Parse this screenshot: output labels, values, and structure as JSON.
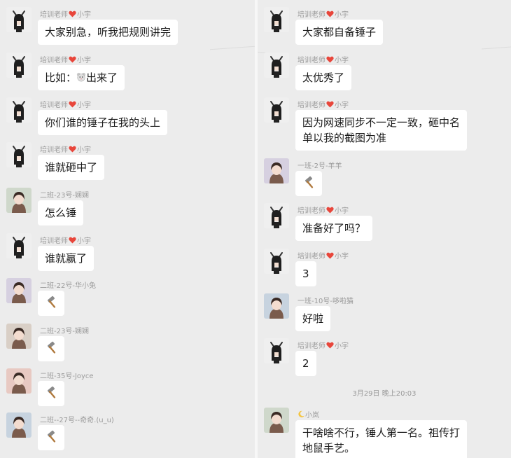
{
  "left": [
    {
      "sender": "培训老师",
      "name2": "小宇",
      "teacher": true,
      "text": "大家别急，听我把规则讲完",
      "avatar": "teacher-avatar"
    },
    {
      "sender": "培训老师",
      "name2": "小宇",
      "teacher": true,
      "text_pre": "比如：",
      "text_post": "出来了",
      "emoji": "mouse-emoji-icon",
      "avatar": "teacher-avatar"
    },
    {
      "sender": "培训老师",
      "name2": "小宇",
      "teacher": true,
      "text": "你们谁的锤子在我的头上",
      "avatar": "teacher-avatar"
    },
    {
      "sender": "培训老师",
      "name2": "小宇",
      "teacher": true,
      "text": "谁就砸中了",
      "avatar": "teacher-avatar"
    },
    {
      "sender": "二班-23号-娴娴",
      "text": "怎么锤",
      "avatar": "student-avatar"
    },
    {
      "sender": "培训老师",
      "name2": "小宇",
      "teacher": true,
      "text": "谁就赢了",
      "avatar": "teacher-avatar"
    },
    {
      "sender": "二班-22号-华小兔",
      "hammer": true,
      "avatar": "student-avatar"
    },
    {
      "sender": "二班-23号-娴娴",
      "hammer": true,
      "avatar": "student-avatar"
    },
    {
      "sender": "二班-35号-Joyce",
      "hammer": true,
      "avatar": "student-avatar"
    },
    {
      "sender": "二班--27号--奇奇.(u_u)",
      "hammer": true,
      "avatar": "student-avatar"
    }
  ],
  "right": [
    {
      "sender": "培训老师",
      "name2": "小宇",
      "teacher": true,
      "text": "大家都自备锤子",
      "avatar": "teacher-avatar"
    },
    {
      "sender": "培训老师",
      "name2": "小宇",
      "teacher": true,
      "text": "太优秀了",
      "avatar": "teacher-avatar"
    },
    {
      "sender": "培训老师",
      "name2": "小宇",
      "teacher": true,
      "text": "因为网速同步不一定一致，砸中名\n单以我的截图为准",
      "avatar": "teacher-avatar"
    },
    {
      "sender": "一班-2号-羊羊",
      "hammer": true,
      "avatar": "student-avatar"
    },
    {
      "sender": "培训老师",
      "name2": "小宇",
      "teacher": true,
      "text": "准备好了吗？",
      "avatar": "teacher-avatar"
    },
    {
      "sender": "培训老师",
      "name2": "小宇",
      "teacher": true,
      "text": "3",
      "avatar": "teacher-avatar"
    },
    {
      "sender": "一班-10号-哆啦猫",
      "text": "好啦",
      "avatar": "student-avatar"
    },
    {
      "sender": "培训老师",
      "name2": "小宇",
      "teacher": true,
      "text": "2",
      "avatar": "teacher-avatar"
    },
    {
      "sender": "小岚",
      "moon": true,
      "text": "干啥啥不行，锤人第一名。祖传打\n地鼠手艺。",
      "avatar": "student-avatar"
    }
  ],
  "timestamp": "3月29日 晚上20:03",
  "colors": {
    "background": "#ececec",
    "bubble": "#ffffff",
    "meta": "#9a9a9a",
    "heart": "#e8463b"
  }
}
